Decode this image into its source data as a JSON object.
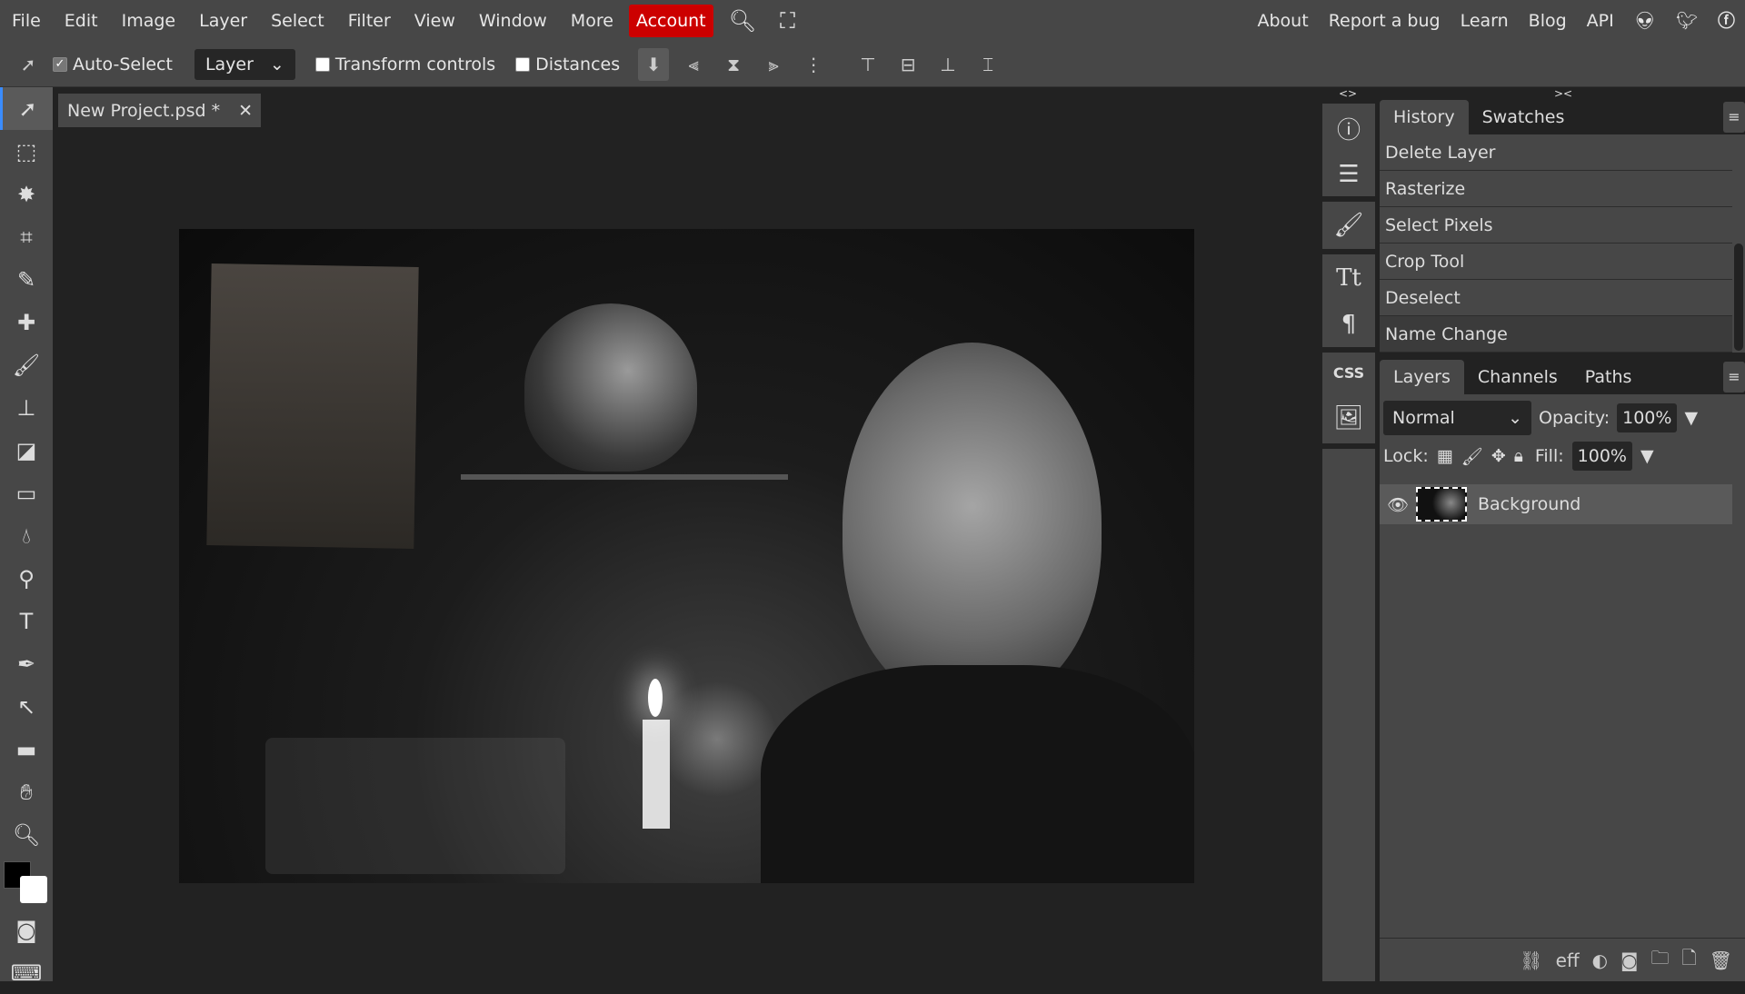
{
  "menubar": {
    "items": [
      "File",
      "Edit",
      "Image",
      "Layer",
      "Select",
      "Filter",
      "View",
      "Window",
      "More"
    ],
    "account": "Account",
    "right_links": [
      "About",
      "Report a bug",
      "Learn",
      "Blog",
      "API"
    ],
    "social_icons": [
      "reddit-icon",
      "twitter-icon",
      "facebook-icon"
    ],
    "accent": "#cc0000"
  },
  "options": {
    "auto_select": "Auto-Select",
    "auto_select_checked": true,
    "select_value": "Layer",
    "transform_controls": "Transform controls",
    "transform_checked": false,
    "distances": "Distances",
    "distances_checked": false
  },
  "document": {
    "tab_title": "New Project.psd *",
    "close": "✕"
  },
  "panel_toggles": {
    "left": "<>",
    "right": "><"
  },
  "history": {
    "tabs": [
      "History",
      "Swatches"
    ],
    "items": [
      "Delete Layer",
      "Rasterize",
      "Select Pixels",
      "Crop Tool",
      "Deselect",
      "Name Change"
    ]
  },
  "layers": {
    "tabs": [
      "Layers",
      "Channels",
      "Paths"
    ],
    "blend_mode": "Normal",
    "opacity_label": "Opacity:",
    "opacity": "100%",
    "lock_label": "Lock:",
    "fill_label": "Fill:",
    "fill": "100%",
    "items": [
      {
        "name": "Background",
        "visible": true
      }
    ]
  },
  "iconcol": {
    "css_label": "CSS"
  },
  "bottom_icons": [
    "link-icon",
    "effects-icon",
    "adjustment-icon",
    "mask-icon",
    "folder-icon",
    "new-layer-icon",
    "trash-icon"
  ],
  "bottom_eff": "eff"
}
